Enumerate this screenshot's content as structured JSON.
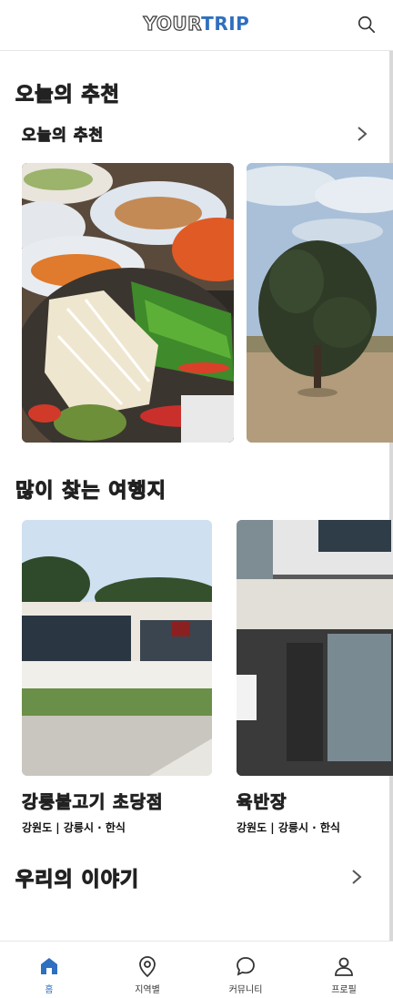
{
  "header": {
    "logo_part1": "YOUR",
    "logo_part2": "TRIP",
    "search_icon": "search-icon"
  },
  "today": {
    "section_title": "오늘의 추천",
    "subtitle": "오늘의 추천",
    "cards": [
      {
        "kind": "food-photo"
      },
      {
        "kind": "tree-photo"
      }
    ]
  },
  "popular": {
    "section_title": "많이 찾는 여행지",
    "places": [
      {
        "name": "강릉불고기 초당점",
        "meta": "강원도 | 강릉시  ·  한식"
      },
      {
        "name": "육반장",
        "meta": "강원도 | 강릉시  ·  한식"
      }
    ]
  },
  "story": {
    "section_title": "우리의 이야기"
  },
  "nav": {
    "items": [
      {
        "label": "홈",
        "icon": "home-icon",
        "active": true
      },
      {
        "label": "지역별",
        "icon": "location-pin-icon",
        "active": false
      },
      {
        "label": "커뮤니티",
        "icon": "chat-bubble-icon",
        "active": false
      },
      {
        "label": "프로필",
        "icon": "profile-icon",
        "active": false
      }
    ]
  },
  "colors": {
    "brand": "#2f6fbf",
    "text": "#111111",
    "divider": "#e6e6e6"
  }
}
